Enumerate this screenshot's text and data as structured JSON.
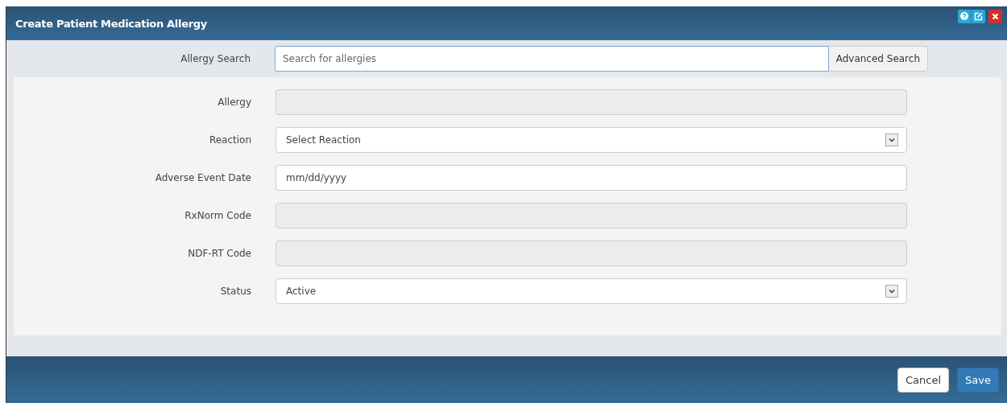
{
  "window": {
    "title": "Create Patient Medication Allergy"
  },
  "search": {
    "label": "Allergy Search",
    "placeholder": "Search for allergies",
    "button": "Advanced Search"
  },
  "fields": [
    {
      "label": "Allergy",
      "kind": "text",
      "disabled": true
    },
    {
      "label": "Reaction",
      "kind": "select",
      "disabled": false,
      "value": "Select Reaction"
    },
    {
      "label": "Adverse Event Date",
      "kind": "date",
      "disabled": false,
      "placeholder": "mm/dd/yyyy"
    },
    {
      "label": "RxNorm Code",
      "kind": "text",
      "disabled": true
    },
    {
      "label": "NDF-RT Code",
      "kind": "text",
      "disabled": true
    },
    {
      "label": "Status",
      "kind": "select",
      "disabled": false,
      "value": "Active"
    }
  ],
  "buttons": [
    {
      "label": "Cancel",
      "kind": "default"
    },
    {
      "label": "Save",
      "kind": "primary"
    }
  ]
}
